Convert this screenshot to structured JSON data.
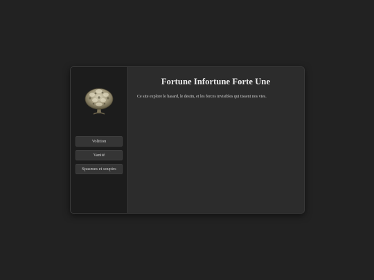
{
  "colors": {
    "background": "#222222",
    "sidebar": "#1c1c1c",
    "panel": "#2c2c2c",
    "nav_button": "#353535",
    "text": "#ededed"
  },
  "sidebar": {
    "logo_icon": "ornate-tree-emblem-icon",
    "items": [
      {
        "label": "Volition"
      },
      {
        "label": "Vanité"
      },
      {
        "label": "Spasmes et soupirs"
      }
    ]
  },
  "main": {
    "title": "Fortune Infortune Forte Une",
    "description": "Ce site explore le hasard, le destin, et les forces invisibles qui tissent nos vies."
  }
}
